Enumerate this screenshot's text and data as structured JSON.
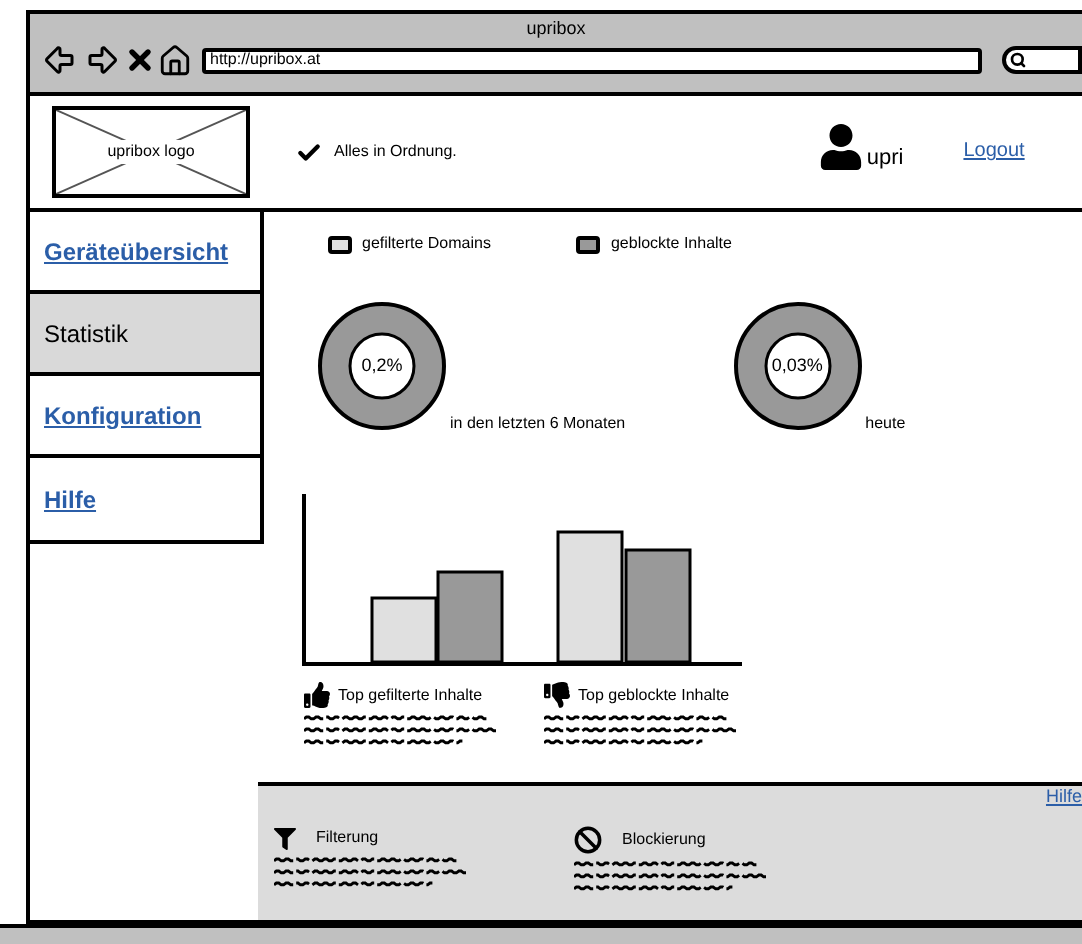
{
  "window": {
    "title": "upribox"
  },
  "address_bar": {
    "value": "http://upribox.at"
  },
  "header": {
    "logo_label": "upribox logo",
    "status": "Alles in Ordnung.",
    "user": "upri",
    "logout": "Logout"
  },
  "sidebar": {
    "items": [
      {
        "label": "Geräteübersicht",
        "selected": false
      },
      {
        "label": "Statistik",
        "selected": true
      },
      {
        "label": "Konfiguration",
        "selected": false
      },
      {
        "label": "Hilfe",
        "selected": false
      }
    ]
  },
  "legend": [
    {
      "label": "gefilterte Domains",
      "color": "#e0e0e0"
    },
    {
      "label": "geblockte Inhalte",
      "color": "#999999"
    }
  ],
  "donuts": [
    {
      "value": "0,2%",
      "caption": "in den letzten 6 Monaten"
    },
    {
      "value": "0,03%",
      "caption": "heute"
    }
  ],
  "top_lists": [
    {
      "kind": "thumbs-up",
      "title": "Top gefilterte Inhalte"
    },
    {
      "kind": "thumbs-down",
      "title": "Top geblockte Inhalte"
    }
  ],
  "footer_panel": {
    "help_link": "Hilfe",
    "sections": [
      {
        "kind": "filter",
        "title": "Filterung"
      },
      {
        "kind": "block",
        "title": "Blockierung"
      }
    ]
  }
}
